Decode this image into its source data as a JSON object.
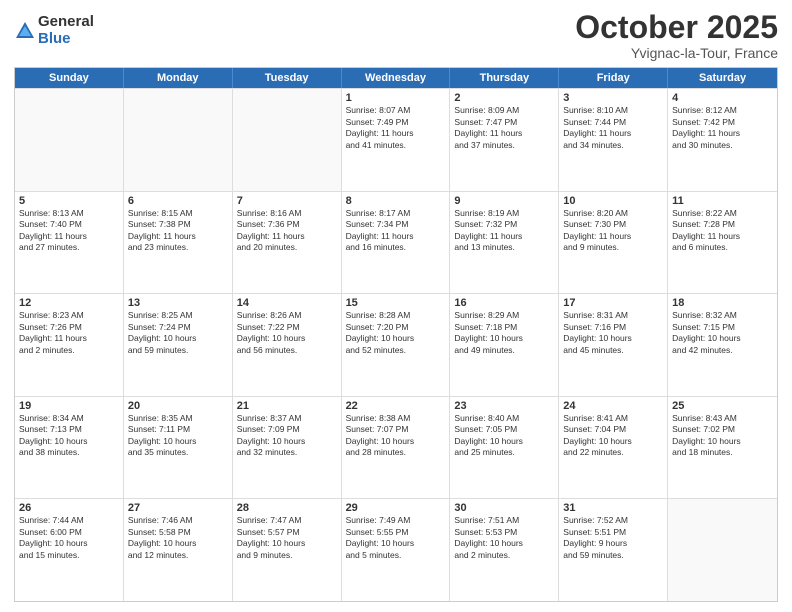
{
  "logo": {
    "general": "General",
    "blue": "Blue"
  },
  "title": "October 2025",
  "location": "Yvignac-la-Tour, France",
  "header_days": [
    "Sunday",
    "Monday",
    "Tuesday",
    "Wednesday",
    "Thursday",
    "Friday",
    "Saturday"
  ],
  "weeks": [
    [
      {
        "day": "",
        "info": ""
      },
      {
        "day": "",
        "info": ""
      },
      {
        "day": "",
        "info": ""
      },
      {
        "day": "1",
        "info": "Sunrise: 8:07 AM\nSunset: 7:49 PM\nDaylight: 11 hours\nand 41 minutes."
      },
      {
        "day": "2",
        "info": "Sunrise: 8:09 AM\nSunset: 7:47 PM\nDaylight: 11 hours\nand 37 minutes."
      },
      {
        "day": "3",
        "info": "Sunrise: 8:10 AM\nSunset: 7:44 PM\nDaylight: 11 hours\nand 34 minutes."
      },
      {
        "day": "4",
        "info": "Sunrise: 8:12 AM\nSunset: 7:42 PM\nDaylight: 11 hours\nand 30 minutes."
      }
    ],
    [
      {
        "day": "5",
        "info": "Sunrise: 8:13 AM\nSunset: 7:40 PM\nDaylight: 11 hours\nand 27 minutes."
      },
      {
        "day": "6",
        "info": "Sunrise: 8:15 AM\nSunset: 7:38 PM\nDaylight: 11 hours\nand 23 minutes."
      },
      {
        "day": "7",
        "info": "Sunrise: 8:16 AM\nSunset: 7:36 PM\nDaylight: 11 hours\nand 20 minutes."
      },
      {
        "day": "8",
        "info": "Sunrise: 8:17 AM\nSunset: 7:34 PM\nDaylight: 11 hours\nand 16 minutes."
      },
      {
        "day": "9",
        "info": "Sunrise: 8:19 AM\nSunset: 7:32 PM\nDaylight: 11 hours\nand 13 minutes."
      },
      {
        "day": "10",
        "info": "Sunrise: 8:20 AM\nSunset: 7:30 PM\nDaylight: 11 hours\nand 9 minutes."
      },
      {
        "day": "11",
        "info": "Sunrise: 8:22 AM\nSunset: 7:28 PM\nDaylight: 11 hours\nand 6 minutes."
      }
    ],
    [
      {
        "day": "12",
        "info": "Sunrise: 8:23 AM\nSunset: 7:26 PM\nDaylight: 11 hours\nand 2 minutes."
      },
      {
        "day": "13",
        "info": "Sunrise: 8:25 AM\nSunset: 7:24 PM\nDaylight: 10 hours\nand 59 minutes."
      },
      {
        "day": "14",
        "info": "Sunrise: 8:26 AM\nSunset: 7:22 PM\nDaylight: 10 hours\nand 56 minutes."
      },
      {
        "day": "15",
        "info": "Sunrise: 8:28 AM\nSunset: 7:20 PM\nDaylight: 10 hours\nand 52 minutes."
      },
      {
        "day": "16",
        "info": "Sunrise: 8:29 AM\nSunset: 7:18 PM\nDaylight: 10 hours\nand 49 minutes."
      },
      {
        "day": "17",
        "info": "Sunrise: 8:31 AM\nSunset: 7:16 PM\nDaylight: 10 hours\nand 45 minutes."
      },
      {
        "day": "18",
        "info": "Sunrise: 8:32 AM\nSunset: 7:15 PM\nDaylight: 10 hours\nand 42 minutes."
      }
    ],
    [
      {
        "day": "19",
        "info": "Sunrise: 8:34 AM\nSunset: 7:13 PM\nDaylight: 10 hours\nand 38 minutes."
      },
      {
        "day": "20",
        "info": "Sunrise: 8:35 AM\nSunset: 7:11 PM\nDaylight: 10 hours\nand 35 minutes."
      },
      {
        "day": "21",
        "info": "Sunrise: 8:37 AM\nSunset: 7:09 PM\nDaylight: 10 hours\nand 32 minutes."
      },
      {
        "day": "22",
        "info": "Sunrise: 8:38 AM\nSunset: 7:07 PM\nDaylight: 10 hours\nand 28 minutes."
      },
      {
        "day": "23",
        "info": "Sunrise: 8:40 AM\nSunset: 7:05 PM\nDaylight: 10 hours\nand 25 minutes."
      },
      {
        "day": "24",
        "info": "Sunrise: 8:41 AM\nSunset: 7:04 PM\nDaylight: 10 hours\nand 22 minutes."
      },
      {
        "day": "25",
        "info": "Sunrise: 8:43 AM\nSunset: 7:02 PM\nDaylight: 10 hours\nand 18 minutes."
      }
    ],
    [
      {
        "day": "26",
        "info": "Sunrise: 7:44 AM\nSunset: 6:00 PM\nDaylight: 10 hours\nand 15 minutes."
      },
      {
        "day": "27",
        "info": "Sunrise: 7:46 AM\nSunset: 5:58 PM\nDaylight: 10 hours\nand 12 minutes."
      },
      {
        "day": "28",
        "info": "Sunrise: 7:47 AM\nSunset: 5:57 PM\nDaylight: 10 hours\nand 9 minutes."
      },
      {
        "day": "29",
        "info": "Sunrise: 7:49 AM\nSunset: 5:55 PM\nDaylight: 10 hours\nand 5 minutes."
      },
      {
        "day": "30",
        "info": "Sunrise: 7:51 AM\nSunset: 5:53 PM\nDaylight: 10 hours\nand 2 minutes."
      },
      {
        "day": "31",
        "info": "Sunrise: 7:52 AM\nSunset: 5:51 PM\nDaylight: 9 hours\nand 59 minutes."
      },
      {
        "day": "",
        "info": ""
      }
    ]
  ]
}
